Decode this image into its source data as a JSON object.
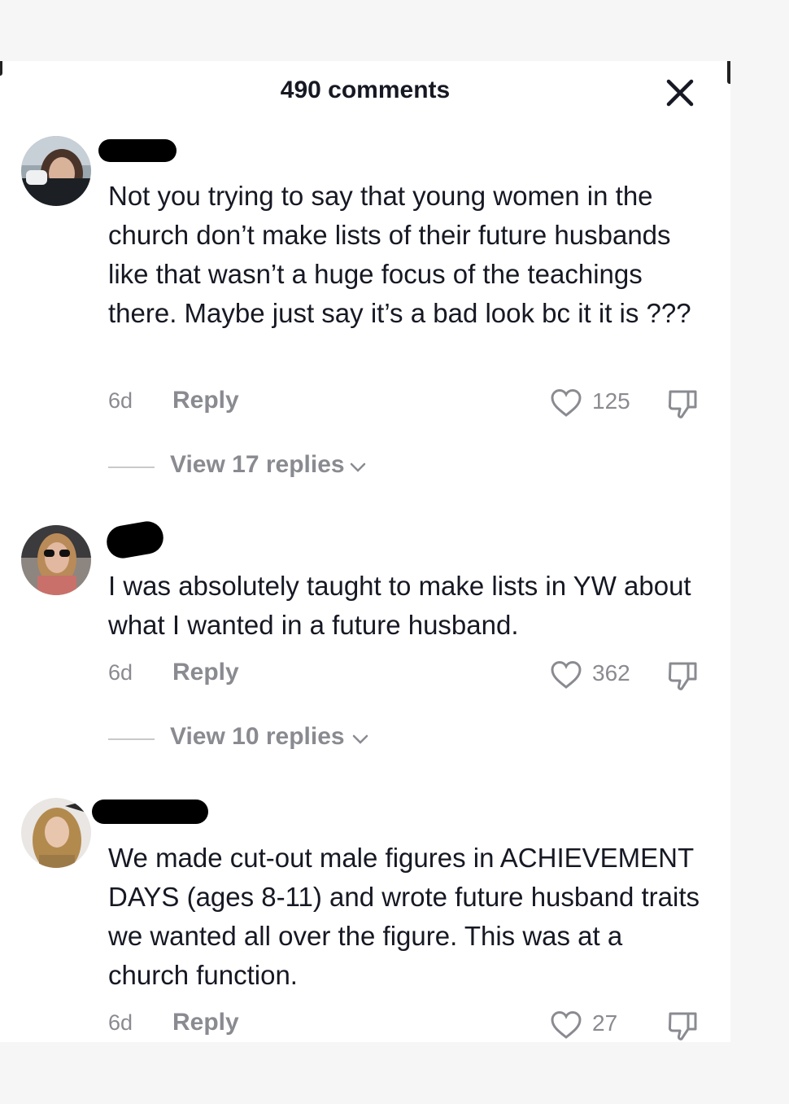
{
  "header": {
    "title": "490 comments"
  },
  "icons": {
    "close": "close-icon",
    "like": "heart-icon",
    "dislike": "thumbs-down-icon",
    "expand": "chevron-down-icon"
  },
  "colors": {
    "text": "#161823",
    "muted": "#8a8b91",
    "background": "#ffffff"
  },
  "comments": [
    {
      "text": "Not you trying to say that young women in the church don’t make lists of their future husbands like that wasn’t a huge focus of the teachings there. Maybe just say it’s a bad look bc it it is ???",
      "time": "6d",
      "reply_label": "Reply",
      "likes": "125",
      "replies_label": "View 17 replies"
    },
    {
      "text": "I was absolutely taught to make lists in YW about what I wanted in a future husband.",
      "time": "6d",
      "reply_label": "Reply",
      "likes": "362",
      "replies_label": "View 10 replies"
    },
    {
      "text": "We made cut-out male figures in ACHIEVEMENT DAYS (ages 8-11) and wrote future husband traits we wanted all over the figure. This was at a church function.",
      "time": "6d",
      "reply_label": "Reply",
      "likes": "27"
    }
  ]
}
